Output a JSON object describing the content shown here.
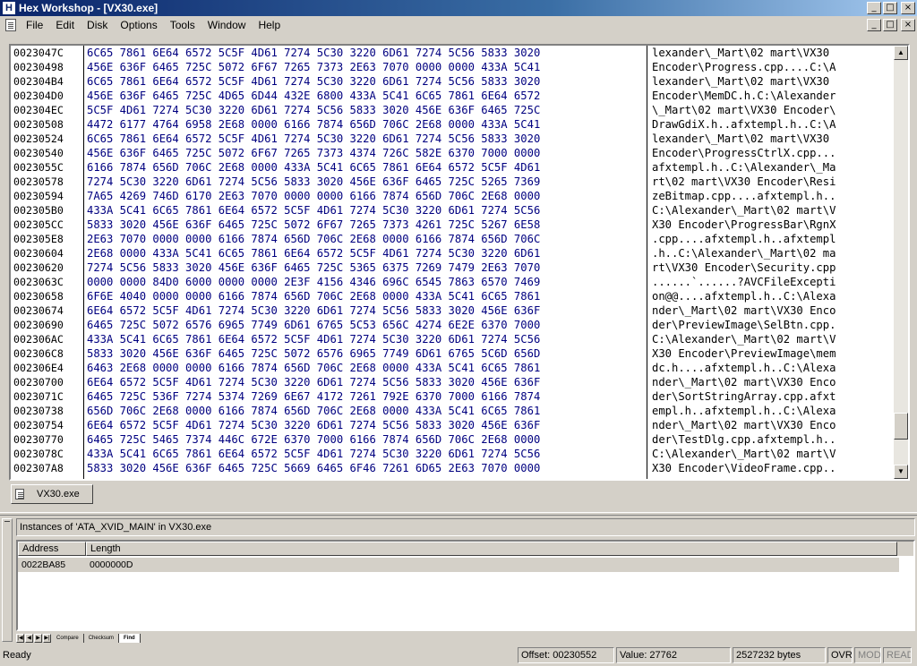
{
  "app": {
    "title": "Hex Workshop - [VX30.exe]",
    "icon_letter": "H",
    "window_buttons": [
      "_",
      "□",
      "×"
    ]
  },
  "menu": [
    "File",
    "Edit",
    "Disk",
    "Options",
    "Tools",
    "Window",
    "Help"
  ],
  "hex": {
    "rows": [
      {
        "addr": "0023047C",
        "hex": "6C65 7861 6E64 6572 5C5F 4D61 7274 5C30 3220 6D61 7274 5C56 5833 3020",
        "ascii": "lexander\\_Mart\\02 mart\\VX30 "
      },
      {
        "addr": "00230498",
        "hex": "456E 636F 6465 725C 5072 6F67 7265 7373 2E63 7070 0000 0000 433A 5C41",
        "ascii": "Encoder\\Progress.cpp....C:\\A"
      },
      {
        "addr": "002304B4",
        "hex": "6C65 7861 6E64 6572 5C5F 4D61 7274 5C30 3220 6D61 7274 5C56 5833 3020",
        "ascii": "lexander\\_Mart\\02 mart\\VX30 "
      },
      {
        "addr": "002304D0",
        "hex": "456E 636F 6465 725C 4D65 6D44 432E 6800 433A 5C41 6C65 7861 6E64 6572",
        "ascii": "Encoder\\MemDC.h.C:\\Alexander"
      },
      {
        "addr": "002304EC",
        "hex": "5C5F 4D61 7274 5C30 3220 6D61 7274 5C56 5833 3020 456E 636F 6465 725C",
        "ascii": "\\_Mart\\02 mart\\VX30 Encoder\\"
      },
      {
        "addr": "00230508",
        "hex": "4472 6177 4764 6958 2E68 0000 6166 7874 656D 706C 2E68 0000 433A 5C41",
        "ascii": "DrawGdiX.h..afxtempl.h..C:\\A"
      },
      {
        "addr": "00230524",
        "hex": "6C65 7861 6E64 6572 5C5F 4D61 7274 5C30 3220 6D61 7274 5C56 5833 3020",
        "ascii": "lexander\\_Mart\\02 mart\\VX30 "
      },
      {
        "addr": "00230540",
        "hex": "456E 636F 6465 725C 5072 6F67 7265 7373 4374 726C 582E 6370 7000 0000",
        "ascii": "Encoder\\ProgressCtrlX.cpp..."
      },
      {
        "addr": "0023055C",
        "hex": "6166 7874 656D 706C 2E68 0000 433A 5C41 6C65 7861 6E64 6572 5C5F 4D61",
        "ascii": "afxtempl.h..C:\\Alexander\\_Ma"
      },
      {
        "addr": "00230578",
        "hex": "7274 5C30 3220 6D61 7274 5C56 5833 3020 456E 636F 6465 725C 5265 7369",
        "ascii": "rt\\02 mart\\VX30 Encoder\\Resi"
      },
      {
        "addr": "00230594",
        "hex": "7A65 4269 746D 6170 2E63 7070 0000 0000 6166 7874 656D 706C 2E68 0000",
        "ascii": "zeBitmap.cpp....afxtempl.h.."
      },
      {
        "addr": "002305B0",
        "hex": "433A 5C41 6C65 7861 6E64 6572 5C5F 4D61 7274 5C30 3220 6D61 7274 5C56",
        "ascii": "C:\\Alexander\\_Mart\\02 mart\\V"
      },
      {
        "addr": "002305CC",
        "hex": "5833 3020 456E 636F 6465 725C 5072 6F67 7265 7373 4261 725C 5267 6E58",
        "ascii": "X30 Encoder\\ProgressBar\\RgnX"
      },
      {
        "addr": "002305E8",
        "hex": "2E63 7070 0000 0000 6166 7874 656D 706C 2E68 0000 6166 7874 656D 706C",
        "ascii": ".cpp....afxtempl.h..afxtempl"
      },
      {
        "addr": "00230604",
        "hex": "2E68 0000 433A 5C41 6C65 7861 6E64 6572 5C5F 4D61 7274 5C30 3220 6D61",
        "ascii": ".h..C:\\Alexander\\_Mart\\02 ma"
      },
      {
        "addr": "00230620",
        "hex": "7274 5C56 5833 3020 456E 636F 6465 725C 5365 6375 7269 7479 2E63 7070",
        "ascii": "rt\\VX30 Encoder\\Security.cpp"
      },
      {
        "addr": "0023063C",
        "hex": "0000 0000 84D0 6000 0000 0000 2E3F 4156 4346 696C 6545 7863 6570 7469",
        "ascii": "......`......?AVCFileExcepti"
      },
      {
        "addr": "00230658",
        "hex": "6F6E 4040 0000 0000 6166 7874 656D 706C 2E68 0000 433A 5C41 6C65 7861",
        "ascii": "on@@....afxtempl.h..C:\\Alexa"
      },
      {
        "addr": "00230674",
        "hex": "6E64 6572 5C5F 4D61 7274 5C30 3220 6D61 7274 5C56 5833 3020 456E 636F",
        "ascii": "nder\\_Mart\\02 mart\\VX30 Enco"
      },
      {
        "addr": "00230690",
        "hex": "6465 725C 5072 6576 6965 7749 6D61 6765 5C53 656C 4274 6E2E 6370 7000",
        "ascii": "der\\PreviewImage\\SelBtn.cpp."
      },
      {
        "addr": "002306AC",
        "hex": "433A 5C41 6C65 7861 6E64 6572 5C5F 4D61 7274 5C30 3220 6D61 7274 5C56",
        "ascii": "C:\\Alexander\\_Mart\\02 mart\\V"
      },
      {
        "addr": "002306C8",
        "hex": "5833 3020 456E 636F 6465 725C 5072 6576 6965 7749 6D61 6765 5C6D 656D",
        "ascii": "X30 Encoder\\PreviewImage\\mem"
      },
      {
        "addr": "002306E4",
        "hex": "6463 2E68 0000 0000 6166 7874 656D 706C 2E68 0000 433A 5C41 6C65 7861",
        "ascii": "dc.h....afxtempl.h..C:\\Alexa"
      },
      {
        "addr": "00230700",
        "hex": "6E64 6572 5C5F 4D61 7274 5C30 3220 6D61 7274 5C56 5833 3020 456E 636F",
        "ascii": "nder\\_Mart\\02 mart\\VX30 Enco"
      },
      {
        "addr": "0023071C",
        "hex": "6465 725C 536F 7274 5374 7269 6E67 4172 7261 792E 6370 7000 6166 7874",
        "ascii": "der\\SortStringArray.cpp.afxt"
      },
      {
        "addr": "00230738",
        "hex": "656D 706C 2E68 0000 6166 7874 656D 706C 2E68 0000 433A 5C41 6C65 7861",
        "ascii": "empl.h..afxtempl.h..C:\\Alexa"
      },
      {
        "addr": "00230754",
        "hex": "6E64 6572 5C5F 4D61 7274 5C30 3220 6D61 7274 5C56 5833 3020 456E 636F",
        "ascii": "nder\\_Mart\\02 mart\\VX30 Enco"
      },
      {
        "addr": "00230770",
        "hex": "6465 725C 5465 7374 446C 672E 6370 7000 6166 7874 656D 706C 2E68 0000",
        "ascii": "der\\TestDlg.cpp.afxtempl.h.."
      },
      {
        "addr": "0023078C",
        "hex": "433A 5C41 6C65 7861 6E64 6572 5C5F 4D61 7274 5C30 3220 6D61 7274 5C56",
        "ascii": "C:\\Alexander\\_Mart\\02 mart\\V"
      },
      {
        "addr": "002307A8",
        "hex": "5833 3020 456E 636F 6465 725C 5669 6465 6F46 7261 6D65 2E63 7070 0000",
        "ascii": "X30 Encoder\\VideoFrame.cpp.."
      }
    ]
  },
  "doc_tab": "VX30.exe",
  "results": {
    "title": "Instances of 'ATA_XVID_MAIN' in VX30.exe",
    "columns": [
      "Address",
      "Length"
    ],
    "rows": [
      {
        "address": "0022BA85",
        "length": "0000000D"
      }
    ],
    "tabs": [
      "Compare",
      "Checksum",
      "Find"
    ],
    "active_tab": "Find"
  },
  "status": {
    "ready": "Ready",
    "offset": "Offset: 00230552",
    "value": "Value: 27762",
    "size": "2527232 bytes",
    "ovr": "OVR",
    "mod": "MOD",
    "read": "READ"
  },
  "colors": {
    "hex_text": "#000080",
    "titlebar_start": "#0a246a",
    "titlebar_end": "#a6caf0"
  }
}
